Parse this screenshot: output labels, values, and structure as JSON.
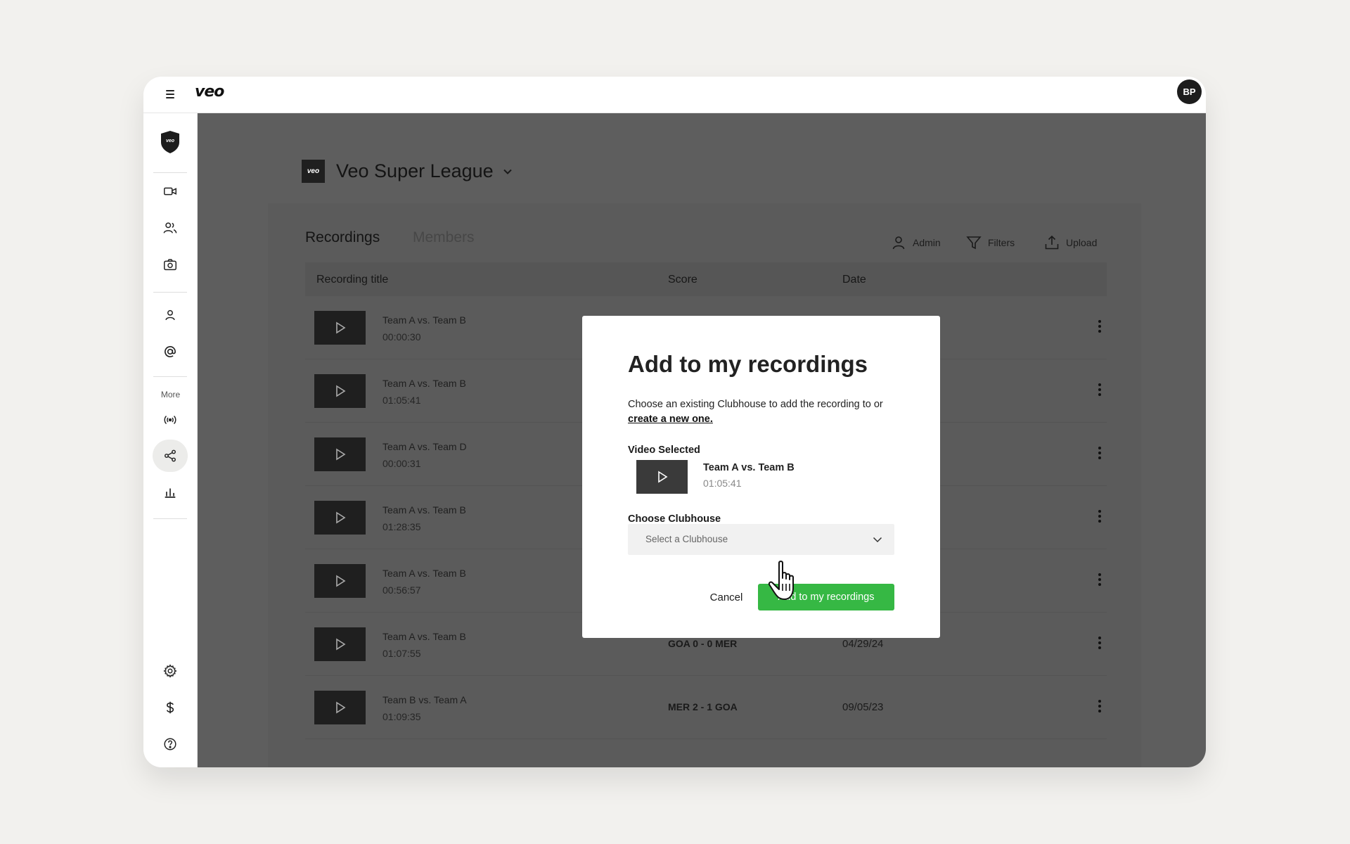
{
  "app": {
    "logo": "veo",
    "avatar_initials": "BP"
  },
  "sidebar": {
    "more_label": "More"
  },
  "league": {
    "logo_text": "veo",
    "name": "Veo Super League"
  },
  "tabs": [
    {
      "label": "Recordings"
    },
    {
      "label": "Members"
    }
  ],
  "toolbar": {
    "admin_label": "Admin",
    "filters_label": "Filters",
    "upload_label": "Upload"
  },
  "table": {
    "headers": {
      "title": "Recording title",
      "score": "Score",
      "date": "Date"
    },
    "rows": [
      {
        "title": "Team A vs. Team B",
        "duration": "00:00:30",
        "score": "",
        "date": ""
      },
      {
        "title": "Team A vs. Team B",
        "duration": "01:05:41",
        "score": "",
        "date": ""
      },
      {
        "title": "Team A vs. Team D",
        "duration": "00:00:31",
        "score": "",
        "date": ""
      },
      {
        "title": "Team A vs. Team B",
        "duration": "01:28:35",
        "score": "",
        "date": ""
      },
      {
        "title": "Team A vs. Team B",
        "duration": "00:56:57",
        "score": "",
        "date": ""
      },
      {
        "title": "Team A vs. Team B",
        "duration": "01:07:55",
        "score": "GOA 0 - 0 MER",
        "date": "04/29/24"
      },
      {
        "title": "Team B vs. Team A",
        "duration": "01:09:35",
        "score": "MER 2 - 1 GOA",
        "date": "09/05/23"
      }
    ]
  },
  "modal": {
    "title": "Add to my recordings",
    "description": "Choose an existing Clubhouse to add the recording to or",
    "link_text": "create a new one.",
    "video_selected_label": "Video Selected",
    "video_title": "Team A vs. Team B",
    "video_duration": "01:05:41",
    "choose_label": "Choose Clubhouse",
    "select_placeholder": "Select a Clubhouse",
    "cancel_label": "Cancel",
    "add_label": "Add to my recordings"
  },
  "colors": {
    "accent_green": "#36b844",
    "overlay": "#5e5e5e",
    "background": "#f2f1ee"
  }
}
